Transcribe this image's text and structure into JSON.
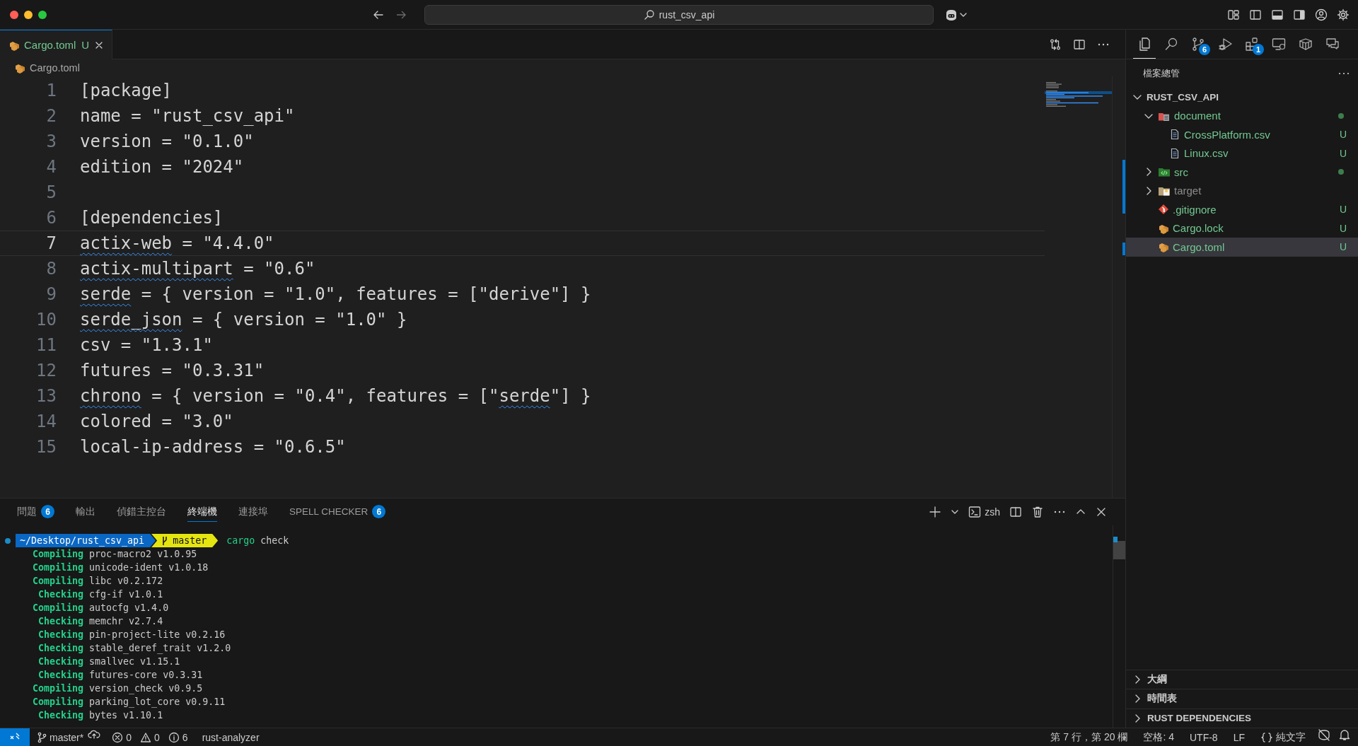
{
  "title_bar": {
    "search_text": "rust_csv_api"
  },
  "editor": {
    "tabs": [
      {
        "label": "Cargo.toml",
        "decoration": "U",
        "selected": true
      }
    ],
    "breadcrumb": [
      "Cargo.toml"
    ],
    "lines": [
      {
        "number": "1",
        "current": false,
        "segments": [
          {
            "text": "[package]",
            "kind": "plain"
          }
        ]
      },
      {
        "number": "2",
        "current": false,
        "segments": [
          {
            "text": "name = \"rust_csv_api\"",
            "kind": "plain"
          }
        ]
      },
      {
        "number": "3",
        "current": false,
        "segments": [
          {
            "text": "version = \"0.1.0\"",
            "kind": "plain"
          }
        ]
      },
      {
        "number": "4",
        "current": false,
        "segments": [
          {
            "text": "edition = \"2024\"",
            "kind": "plain"
          }
        ]
      },
      {
        "number": "5",
        "current": false
      },
      {
        "number": "6",
        "current": false,
        "segments": [
          {
            "text": "[dependencies]",
            "kind": "plain"
          }
        ]
      },
      {
        "number": "7",
        "current": true,
        "segments": [
          {
            "text": "actix-web",
            "kind": "misspelled"
          },
          {
            "text": " = \"4.4.0\"",
            "kind": "plain"
          }
        ]
      },
      {
        "number": "8",
        "current": false,
        "segments": [
          {
            "text": "actix-multipart",
            "kind": "misspelled"
          },
          {
            "text": " = \"0.6\"",
            "kind": "plain"
          }
        ]
      },
      {
        "number": "9",
        "current": false,
        "segments": [
          {
            "text": "serde",
            "kind": "misspelled"
          },
          {
            "text": " = { version = \"1.0\", features = [\"derive\"] }",
            "kind": "plain"
          }
        ]
      },
      {
        "number": "10",
        "current": false,
        "segments": [
          {
            "text": "serde_json",
            "kind": "misspelled"
          },
          {
            "text": " = { version = \"1.0\" }",
            "kind": "plain"
          }
        ]
      },
      {
        "number": "11",
        "current": false,
        "segments": [
          {
            "text": "csv = \"1.3.1\"",
            "kind": "plain"
          }
        ]
      },
      {
        "number": "12",
        "current": false,
        "segments": [
          {
            "text": "futures = \"0.3.31\"",
            "kind": "plain"
          }
        ]
      },
      {
        "number": "13",
        "current": false,
        "segments": [
          {
            "text": "chrono",
            "kind": "misspelled"
          },
          {
            "text": " = { version = \"0.4\", features = [\"",
            "kind": "plain"
          },
          {
            "text": "serde",
            "kind": "misspelled"
          },
          {
            "text": "\"] }",
            "kind": "plain"
          }
        ]
      },
      {
        "number": "14",
        "current": false,
        "segments": [
          {
            "text": "colored = \"3.0\"",
            "kind": "plain"
          }
        ]
      },
      {
        "number": "15",
        "current": false,
        "segments": [
          {
            "text": "local-ip-address = \"0.6.5\"",
            "kind": "plain"
          }
        ]
      }
    ]
  },
  "panel": {
    "tabs": [
      {
        "label": "問題",
        "badge": "6",
        "selected": false
      },
      {
        "label": "輸出",
        "selected": false
      },
      {
        "label": "偵錯主控台",
        "selected": false
      },
      {
        "label": "終端機",
        "selected": true
      },
      {
        "label": "連接埠",
        "selected": false
      },
      {
        "label": "SPELL CHECKER",
        "badge": "6",
        "selected": false
      }
    ],
    "terminal_name": "zsh",
    "prompt": {
      "path": "~/Desktop/rust_csv_api",
      "branch": "master",
      "command": "cargo",
      "args": "check"
    },
    "output": [
      {
        "status": "Compiling",
        "text": "proc-macro2 v1.0.95"
      },
      {
        "status": "Compiling",
        "text": "unicode-ident v1.0.18"
      },
      {
        "status": "Compiling",
        "text": "libc v0.2.172"
      },
      {
        "status": "Checking",
        "text": "cfg-if v1.0.1"
      },
      {
        "status": "Compiling",
        "text": "autocfg v1.4.0"
      },
      {
        "status": "Checking",
        "text": "memchr v2.7.4"
      },
      {
        "status": "Checking",
        "text": "pin-project-lite v0.2.16"
      },
      {
        "status": "Checking",
        "text": "stable_deref_trait v1.2.0"
      },
      {
        "status": "Checking",
        "text": "smallvec v1.15.1"
      },
      {
        "status": "Checking",
        "text": "futures-core v0.3.31"
      },
      {
        "status": "Compiling",
        "text": "version_check v0.9.5"
      },
      {
        "status": "Compiling",
        "text": "parking_lot_core v0.9.11"
      },
      {
        "status": "Checking",
        "text": "bytes v1.10.1"
      }
    ]
  },
  "sidebar": {
    "activity": [
      {
        "kind": "explorer",
        "selected": true
      },
      {
        "kind": "search",
        "selected": false
      },
      {
        "kind": "source-control",
        "badge": "6",
        "selected": false
      },
      {
        "kind": "run-debug",
        "selected": false
      },
      {
        "kind": "extensions",
        "badge": "1",
        "selected": false
      },
      {
        "kind": "remote",
        "selected": false
      },
      {
        "kind": "containers",
        "selected": false
      },
      {
        "kind": "chat",
        "selected": false
      }
    ],
    "title": "檔案總管",
    "tree": {
      "label": "RUST_CSV_API",
      "kind": "root",
      "expanded": true,
      "selected": false,
      "children": [
        {
          "label": "document",
          "kind": "folder-document",
          "expanded": true,
          "selected": false,
          "modified": true,
          "ignored": false,
          "children": [
            {
              "label": "CrossPlatform.csv",
              "kind": "csv",
              "selected": false,
              "ignored": false,
              "decoration": "U"
            },
            {
              "label": "Linux.csv",
              "kind": "csv",
              "selected": false,
              "ignored": false,
              "decoration": "U"
            }
          ]
        },
        {
          "label": "src",
          "kind": "folder-src",
          "expanded": false,
          "selected": false,
          "modified": true,
          "ignored": false
        },
        {
          "label": "target",
          "kind": "folder-target",
          "expanded": false,
          "selected": false,
          "modified": false,
          "ignored": true
        },
        {
          "label": ".gitignore",
          "kind": "git",
          "selected": false,
          "ignored": false,
          "decoration": "U"
        },
        {
          "label": "Cargo.lock",
          "kind": "cargo",
          "selected": false,
          "ignored": false,
          "decoration": "U"
        },
        {
          "label": "Cargo.toml",
          "kind": "cargo",
          "selected": true,
          "ignored": false,
          "decoration": "U"
        }
      ]
    },
    "sections": [
      {
        "label": "大綱",
        "expanded": false
      },
      {
        "label": "時間表",
        "expanded": false
      },
      {
        "label": "RUST DEPENDENCIES",
        "expanded": false
      }
    ]
  },
  "status_bar": {
    "branch": "master*",
    "errors": "0",
    "warnings": "0",
    "infos": "6",
    "language_server": "rust-analyzer",
    "cursor": "第 7 行，第 20 欄",
    "indent": "空格: 4",
    "encoding": "UTF-8",
    "eol": "LF",
    "language": "純文字"
  }
}
